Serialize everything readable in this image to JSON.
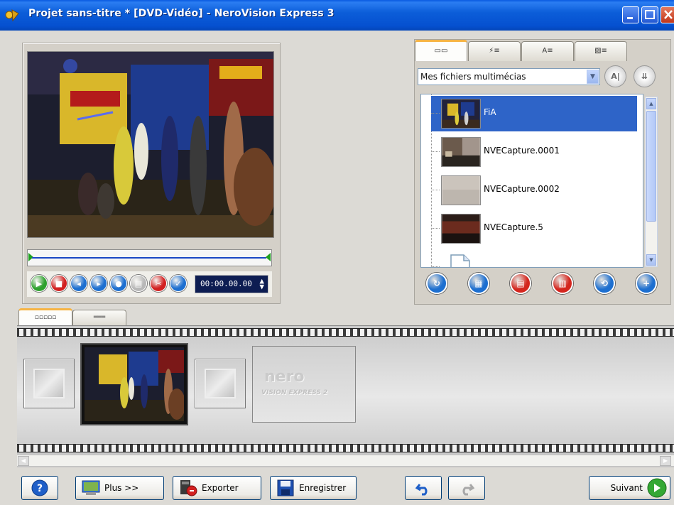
{
  "window": {
    "title": "Projet sans-titre * [DVD-Vidéo] - NeroVision Express 3",
    "title_bar_color": "#0a5be0"
  },
  "preview": {
    "timecode": "00:00.00.00",
    "spinner_icon": "up-down-spinner-icon",
    "controls": [
      {
        "name": "play-button",
        "color": "#2ea12e",
        "glyph": "▶"
      },
      {
        "name": "stop-button",
        "color": "#d22020",
        "glyph": "■"
      },
      {
        "name": "previous-frame-button",
        "color": "#1d6fd0",
        "glyph": "◂"
      },
      {
        "name": "next-frame-button",
        "color": "#1d6fd0",
        "glyph": "▸"
      },
      {
        "name": "microphone-button",
        "color": "#1d6fd0",
        "glyph": "●"
      },
      {
        "name": "film-button",
        "color": "#b8b8b8",
        "glyph": "▤"
      },
      {
        "name": "cut-button",
        "color": "#d22020",
        "glyph": "✂"
      },
      {
        "name": "confirm-button",
        "color": "#1d6fd0",
        "glyph": "✓"
      }
    ]
  },
  "media": {
    "tabs": [
      {
        "label": "▭▭",
        "icon": "film-tab-icon"
      },
      {
        "label": "⚡≡",
        "icon": "effects-tab-icon"
      },
      {
        "label": "A≡",
        "icon": "text-tab-icon"
      },
      {
        "label": "▨≡",
        "icon": "transitions-tab-icon"
      }
    ],
    "source_select": "Mes fichiers multimécias",
    "items": [
      {
        "label": "FiA",
        "thumb": "concert"
      },
      {
        "label": "NVECapture.0001",
        "thumb": "room"
      },
      {
        "label": "NVECapture.0002",
        "thumb": "wall"
      },
      {
        "label": "NVECapture.5",
        "thumb": "dark"
      }
    ],
    "actions": [
      {
        "name": "media-action-1",
        "color": "#1d6fd0",
        "glyph": "↻"
      },
      {
        "name": "media-action-2",
        "color": "#1d6fd0",
        "glyph": "▦"
      },
      {
        "name": "media-action-3",
        "color": "#d4261e",
        "glyph": "▤"
      },
      {
        "name": "media-action-4",
        "color": "#d4261e",
        "glyph": "▥"
      },
      {
        "name": "media-action-5",
        "color": "#1d6fd0",
        "glyph": "⟲"
      },
      {
        "name": "media-action-6",
        "color": "#1d6fd0",
        "glyph": "+"
      }
    ]
  },
  "storyboard": {
    "tabs": [
      "▫▫▫▫▫",
      "═══"
    ],
    "logo_text": "nero",
    "logo_sub": "VISION EXPRESS 2"
  },
  "buttons": {
    "more": "Plus >>",
    "export": "Exporter",
    "save": "Enregistrer",
    "next": "Suivant"
  }
}
